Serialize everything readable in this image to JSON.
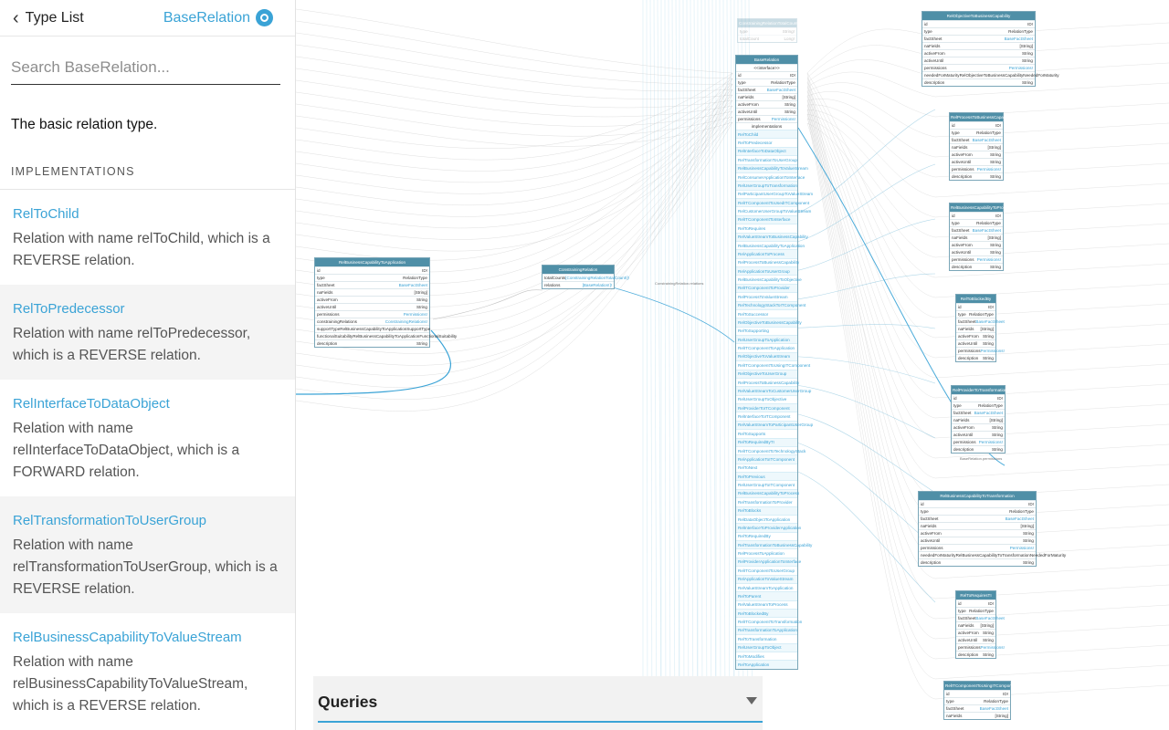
{
  "header": {
    "back_label": "Type List",
    "type_name": "BaseRelation"
  },
  "search": {
    "placeholder": "Search BaseRelation..."
  },
  "type_description": "The basic relation type.",
  "implementations_heading": "IMPLEMENTATIONS",
  "implementations": [
    {
      "name": "RelToChild",
      "description": "Relation with name relToChild, which is a REVERSE relation."
    },
    {
      "name": "RelToPredecessor",
      "description": "Relation with name relToPredecessor, which is a REVERSE relation."
    },
    {
      "name": "RelInterfaceToDataObject",
      "description": "Relation with name relInterfaceToDataObject, which is a FORWARD relation."
    },
    {
      "name": "RelTransformationToUserGroup",
      "description": "Relation with name relTransformationToUserGroup, which is a REVERSE relation."
    },
    {
      "name": "RelBusinessCapabilityToValueStream",
      "description": "Relation with name relBusinessCapabilityToValueStream, which is a REVERSE relation."
    }
  ],
  "queries": {
    "title": "Queries"
  },
  "graph": {
    "base_relation": {
      "title": "BaseRelation",
      "subtitle": "<<interface>>",
      "fields": [
        [
          "id",
          "ID!"
        ],
        [
          "type",
          "RelationType"
        ],
        [
          "factSheet",
          "BaseFactSheet"
        ],
        [
          "naFields",
          "[String]"
        ],
        [
          "activeFrom",
          "String"
        ],
        [
          "activeUntil",
          "String"
        ],
        [
          "permissions",
          "Permissions!"
        ]
      ],
      "implementations_label": "implementations",
      "implementations": [
        "RelToChild",
        "RelToPredecessor",
        "RelInterfaceToDataObject",
        "RelTransformationToUserGroup",
        "RelBusinessCapabilityToValueStream",
        "RelConsumerApplicationToInterface",
        "RelUserGroupToTransformation",
        "RelParticipantUserGroupToValueStream",
        "RelITComponentToUsedITComponent",
        "RelCustomerUserGroupToValueStream",
        "RelITComponentToInterface",
        "RelToRequires",
        "RelValueStreamToBusinessCapability",
        "RelBusinessCapabilityToApplication",
        "RelApplicationToProcess",
        "RelProcessToBusinessCapability",
        "RelApplicationToUserGroup",
        "RelBusinessCapabilityToObjective",
        "RelITComponentToProvider",
        "RelProcessToValueStream",
        "RelTechnologyStackToITComponent",
        "RelToSuccessor",
        "RelObjectiveToBusinessCapability",
        "RelToSupporting",
        "RelUserGroupToApplication",
        "RelITComponentToApplication",
        "RelObjectiveToValueStream",
        "RelITComponentToUsingITComponent",
        "RelObjectiveToUserGroup",
        "RelProcessToBusinessCapability",
        "RelValueStreamToCustomerUserGroup",
        "RelUserGroupToObjective",
        "RelProviderToITComponent",
        "RelInterfaceToITComponent",
        "RelValueStreamToParticipantUserGroup",
        "RelToSupports",
        "RelToRequiredByTI",
        "RelITComponentToTechnologyStack",
        "RelApplicationToITComponent",
        "RelToNext",
        "RelToPrevious",
        "RelUserGroupToITComponent",
        "RelBusinessCapabilityToProcess",
        "RelTransformationToProvider",
        "RelToBlocks",
        "RelDataObjectToApplication",
        "RelInterfaceToProviderApplication",
        "RelToRequiredBy",
        "RelTransformationToBusinessCapability",
        "RelProcessToApplication",
        "RelProviderApplicationToInterface",
        "RelITComponentToUserGroup",
        "RelApplicationToValueStream",
        "RelValueStreamToApplication",
        "RelToParent",
        "RelValueStreamToProcess",
        "RelToBlockedBy",
        "RelITComponentToTransformation",
        "RelTransformationToApplication",
        "RelToTransformation",
        "RelUserGroupToObject",
        "RelToModifies",
        "RelToApplication"
      ]
    },
    "left_node": {
      "title": "RelBusinessCapabilityToApplication",
      "fields": [
        [
          "id",
          "ID!"
        ],
        [
          "type",
          "RelationType"
        ],
        [
          "factSheet",
          "BaseFactSheet"
        ],
        [
          "naFields",
          "[String]"
        ],
        [
          "activeFrom",
          "String"
        ],
        [
          "activeUntil",
          "String"
        ],
        [
          "permissions",
          "Permissions!"
        ],
        [
          "constrainingRelations",
          "ConstrainingRelations!"
        ],
        [
          "supportType",
          "RelBusinessCapabilityToApplicationSupportType"
        ],
        [
          "functionalSuitability",
          "RelBusinessCapabilityToApplicationFunctionalSuitability"
        ],
        [
          "description",
          "String"
        ]
      ]
    },
    "constraining": {
      "title": "ConstrainingRelation",
      "fields": [
        [
          "totalCounts",
          "[ConstrainingRelationTotalCount!]!"
        ],
        [
          "relations",
          "[BaseRelation!]!"
        ]
      ],
      "edge_label": "ConstrainingRelation.relations"
    },
    "ghost": {
      "title": "ConstrainingRelationTotalCount",
      "fields": [
        [
          "type",
          "String!"
        ],
        [
          "totalCount",
          "Long!"
        ]
      ]
    },
    "right_nodes": [
      {
        "title": "RelObjectiveToBusinessCapability",
        "fields": [
          [
            "id",
            "ID!"
          ],
          [
            "type",
            "RelationType"
          ],
          [
            "factSheet",
            "BaseFactSheet"
          ],
          [
            "naFields",
            "[String]"
          ],
          [
            "activeFrom",
            "String"
          ],
          [
            "activeUntil",
            "String"
          ],
          [
            "permissions",
            "Permissions!"
          ],
          [
            "neededForMaturity",
            "RelObjectiveToBusinessCapabilityNeededForMaturity"
          ],
          [
            "description",
            "String"
          ]
        ]
      },
      {
        "title": "RelProcessToBusinessCapability",
        "fields": [
          [
            "id",
            "ID!"
          ],
          [
            "type",
            "RelationType"
          ],
          [
            "factSheet",
            "BaseFactSheet"
          ],
          [
            "naFields",
            "[String]"
          ],
          [
            "activeFrom",
            "String"
          ],
          [
            "activeUntil",
            "String"
          ],
          [
            "permissions",
            "Permissions!"
          ],
          [
            "description",
            "String"
          ]
        ]
      },
      {
        "title": "RelBusinessCapabilityToProcess",
        "fields": [
          [
            "id",
            "ID!"
          ],
          [
            "type",
            "RelationType"
          ],
          [
            "factSheet",
            "BaseFactSheet"
          ],
          [
            "naFields",
            "[String]"
          ],
          [
            "activeFrom",
            "String"
          ],
          [
            "activeUntil",
            "String"
          ],
          [
            "permissions",
            "Permissions!"
          ],
          [
            "description",
            "String"
          ]
        ]
      },
      {
        "title": "RelToBlockedBy",
        "fields": [
          [
            "id",
            "ID!"
          ],
          [
            "type",
            "RelationType"
          ],
          [
            "factSheet",
            "BaseFactSheet"
          ],
          [
            "naFields",
            "[String]"
          ],
          [
            "activeFrom",
            "String"
          ],
          [
            "activeUntil",
            "String"
          ],
          [
            "permissions",
            "Permissions!"
          ],
          [
            "description",
            "String"
          ]
        ]
      },
      {
        "title": "RelProviderToTransformation",
        "fields": [
          [
            "id",
            "ID!"
          ],
          [
            "type",
            "RelationType"
          ],
          [
            "factSheet",
            "BaseFactSheet"
          ],
          [
            "naFields",
            "[String]"
          ],
          [
            "activeFrom",
            "String"
          ],
          [
            "activeUntil",
            "String"
          ],
          [
            "permissions",
            "Permissions!"
          ],
          [
            "description",
            "String"
          ]
        ],
        "caption": "BaseRelation.permissions"
      },
      {
        "title": "RelBusinessCapabilityToTransformation",
        "fields": [
          [
            "id",
            "ID!"
          ],
          [
            "type",
            "RelationType"
          ],
          [
            "factSheet",
            "BaseFactSheet"
          ],
          [
            "naFields",
            "[String]"
          ],
          [
            "activeFrom",
            "String"
          ],
          [
            "activeUntil",
            "String"
          ],
          [
            "permissions",
            "Permissions!"
          ],
          [
            "neededForMaturity",
            "RelBusinessCapabilityToTransformationNeededForMaturity"
          ],
          [
            "description",
            "String"
          ]
        ]
      },
      {
        "title": "RelToRequiresTI",
        "fields": [
          [
            "id",
            "ID!"
          ],
          [
            "type",
            "RelationType"
          ],
          [
            "factSheet",
            "BaseFactSheet"
          ],
          [
            "naFields",
            "[String]"
          ],
          [
            "activeFrom",
            "String"
          ],
          [
            "activeUntil",
            "String"
          ],
          [
            "permissions",
            "Permissions!"
          ],
          [
            "description",
            "String"
          ]
        ]
      },
      {
        "title": "RelITComponentToUsingITComponent",
        "fields": [
          [
            "id",
            "ID!"
          ],
          [
            "type",
            "RelationType"
          ],
          [
            "factSheet",
            "BaseFactSheet"
          ],
          [
            "naFields",
            "[String]"
          ]
        ]
      }
    ]
  },
  "colors": {
    "accent": "#3aa3d6",
    "node_header": "#4f8fa7",
    "wire": "#b8b8b8"
  }
}
